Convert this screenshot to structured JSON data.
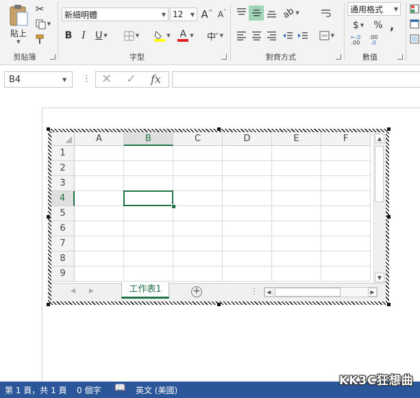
{
  "ribbon": {
    "clipboard": {
      "paste_label": "貼上",
      "group_label": "剪貼簿"
    },
    "font": {
      "font_name": "新細明體",
      "font_size": "12",
      "grow_label": "A",
      "shrink_label": "A",
      "bold_label": "B",
      "italic_label": "I",
      "underline_label": "U",
      "font_color_label": "A",
      "phonetic_label": "中",
      "group_label": "字型",
      "highlight_color": "#ffff00",
      "font_color": "#e02020"
    },
    "alignment": {
      "group_label": "對齊方式"
    },
    "number": {
      "format": "通用格式",
      "currency_label": "$",
      "percent_label": "%",
      "comma_label": ",",
      "increase_decimal_label": ".00",
      "decrease_decimal_label": ".0",
      "group_label": "數值"
    }
  },
  "formula_bar": {
    "name_box": "B4",
    "fx_label": "fx",
    "formula": ""
  },
  "sheet": {
    "columns": [
      "A",
      "B",
      "C",
      "D",
      "E",
      "F"
    ],
    "rows": [
      "1",
      "2",
      "3",
      "4",
      "5",
      "6",
      "7",
      "8",
      "9"
    ],
    "selected_column": "B",
    "selected_row": "4",
    "tab_name": "工作表1",
    "add_sheet_label": "+",
    "accent": "#217346"
  },
  "statusbar": {
    "page_info": "第 1 頁，共 1 頁",
    "word_count": "0 個字",
    "language": "英文 (美國)",
    "color": "#2b579a"
  },
  "watermark": "KK3C狂想曲"
}
